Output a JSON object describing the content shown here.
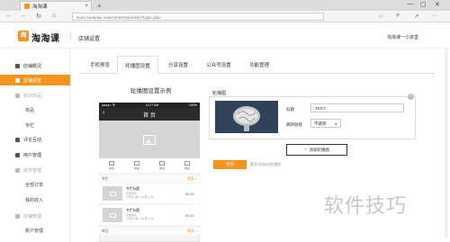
{
  "browser": {
    "tab_title": "淘淘课",
    "tab_close": "×",
    "new_tab": "+",
    "url": "store.taotaoke.com/center/store/info?type=plan",
    "win_min": "—",
    "win_max": "▢",
    "win_close": "✕",
    "back": "←",
    "forward": "→",
    "refresh": "↻",
    "home": "⌂",
    "menu": "···"
  },
  "header": {
    "logo_mark": "淘",
    "logo_text": "淘淘课",
    "title": "店铺设置",
    "user": "淘淘课一小讲堂"
  },
  "sidebar": {
    "items": [
      {
        "label": "店铺概况",
        "state": "normal"
      },
      {
        "label": "店铺设置",
        "state": "active"
      },
      {
        "label": "知识商品",
        "state": "grey"
      },
      {
        "label": "评论互动",
        "state": "normal"
      },
      {
        "label": "用户管理",
        "state": "normal"
      },
      {
        "label": "财务管理",
        "state": "grey"
      },
      {
        "label": "店铺管理",
        "state": "grey"
      }
    ],
    "sub_goods": [
      "单品",
      "专栏"
    ],
    "sub_finance": [
      "全部订单",
      "我的收入"
    ],
    "sub_store": [
      "账户管理"
    ]
  },
  "tabs": [
    "手机预览",
    "轮播图设置",
    "分享设置",
    "公众号设置",
    "功能管理"
  ],
  "preview": {
    "title": "轮播图设置示例",
    "status_left": "●●●●○ 令",
    "status_time": "11:27 AM",
    "status_right": "100%",
    "page_title": "首 页",
    "back": "‹",
    "icons": [
      "单品",
      "单品",
      "单品",
      "单品"
    ],
    "section1": "专栏",
    "section_more": "更多 >",
    "products": [
      {
        "title": "专栏标题",
        "desc": "简要描述",
        "meta": "已更新1期 | 共1期 订阅",
        "price": "¥0.00"
      },
      {
        "title": "专栏标题",
        "desc": "简要描述",
        "meta": "已更新1期 | 共1期 订阅",
        "price": "¥0.00"
      }
    ],
    "section2": "单品"
  },
  "config": {
    "label": "轮播图",
    "close": "×",
    "title_label": "标题",
    "title_value": "TEST",
    "link_label": "跳转链接",
    "link_value": "不跳转",
    "link_caret": "∨",
    "add_label": "添加轮播图",
    "save_label": "保存",
    "save_tip": "最多添加8张轮播图"
  },
  "watermark": "软件技巧",
  "colors": {
    "accent": "#f7941d",
    "price": "#e23b2e"
  }
}
